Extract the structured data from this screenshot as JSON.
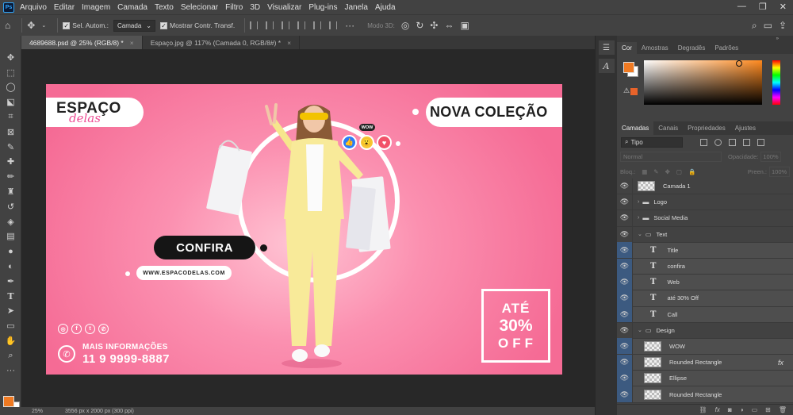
{
  "menubar": {
    "logo": "Ps",
    "items": [
      "Arquivo",
      "Editar",
      "Imagem",
      "Camada",
      "Texto",
      "Selecionar",
      "Filtro",
      "3D",
      "Visualizar",
      "Plug-ins",
      "Janela",
      "Ajuda"
    ]
  },
  "options": {
    "auto_select_label": "Sel. Autom.:",
    "auto_select_target": "Camada",
    "show_transform_label": "Mostrar Contr. Transf.",
    "mode_3d": "Modo 3D:"
  },
  "tabs": [
    {
      "label": "4689688.psd @ 25% (RGB/8) *",
      "close": "×"
    },
    {
      "label": "Espaço.jpg @ 117% (Camada 0, RGB/8#) *",
      "close": "×"
    }
  ],
  "status": {
    "zoom": "25%",
    "doc_info": "3556 px x 2000 px (300 ppi)"
  },
  "design": {
    "logo_main": "ESPAÇO",
    "logo_script": "delas",
    "title": "NOVA COLEÇÃO",
    "cta": "CONFIRA",
    "website": "WWW.ESPACODELAS.COM",
    "wow_label": "WOW",
    "more_info": "MAIS INFORMAÇÕES",
    "phone": "11 9 9999-8887",
    "promo_line1": "ATÉ",
    "promo_line2": "30%",
    "promo_line3": "OFF"
  },
  "color_panel": {
    "tabs": [
      "Cor",
      "Amostras",
      "Degradês",
      "Padrões"
    ],
    "foreground": "#f07a22",
    "background": "#ffffff"
  },
  "layers_panel": {
    "tabs": [
      "Camadas",
      "Canais",
      "Propriedades",
      "Ajustes"
    ],
    "filter_kind": "Tipo",
    "blend_mode": "Normal",
    "opacity_label": "Opacidade:",
    "opacity_value": "100%",
    "lock_label": "Bloq.:",
    "fill_label": "Preen.:",
    "fill_value": "100%",
    "layers": [
      {
        "name": "Camada 1",
        "kind": "pixel",
        "indent": 0
      },
      {
        "name": "Logo",
        "kind": "group",
        "indent": 0,
        "expanded": false
      },
      {
        "name": "Social Media",
        "kind": "group",
        "indent": 0,
        "expanded": false
      },
      {
        "name": "Text",
        "kind": "group",
        "indent": 0,
        "expanded": true
      },
      {
        "name": "Title",
        "kind": "text",
        "indent": 1
      },
      {
        "name": "confira",
        "kind": "text",
        "indent": 1
      },
      {
        "name": "Web",
        "kind": "text",
        "indent": 1
      },
      {
        "name": "até 30% Off",
        "kind": "text",
        "indent": 1
      },
      {
        "name": "Call",
        "kind": "text",
        "indent": 1
      },
      {
        "name": "Design",
        "kind": "group",
        "indent": 0,
        "expanded": true
      },
      {
        "name": "WOW",
        "kind": "shape",
        "indent": 1
      },
      {
        "name": "Rounded Rectangle",
        "kind": "shape",
        "indent": 1,
        "fx": "fx"
      },
      {
        "name": "Ellipse",
        "kind": "shape",
        "indent": 1
      },
      {
        "name": "Rounded Rectangle",
        "kind": "shape",
        "indent": 1
      }
    ]
  }
}
